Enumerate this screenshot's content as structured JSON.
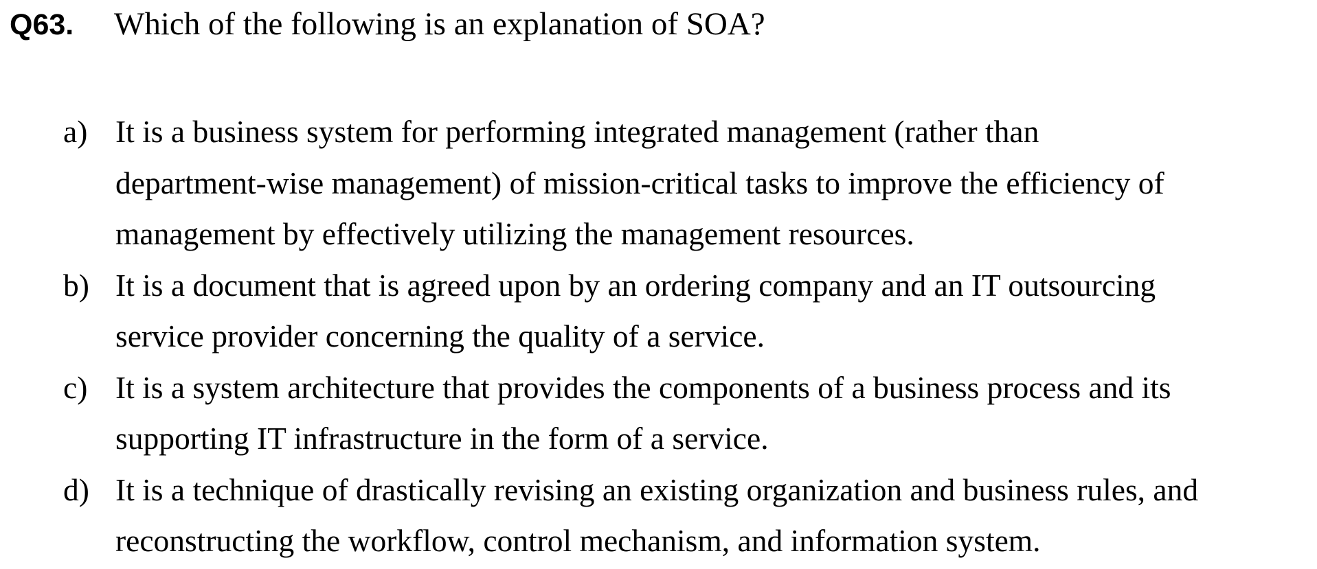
{
  "question": {
    "number": "Q63.",
    "text": "Which of the following is an explanation of SOA?"
  },
  "options": [
    {
      "label": "a)",
      "lines": [
        "It is a business system for performing integrated management (rather than",
        "department-wise management) of mission-critical tasks to improve the efficiency of",
        "management by effectively utilizing the management resources."
      ]
    },
    {
      "label": "b)",
      "lines": [
        "It is a document that is agreed upon by an ordering company and an IT outsourcing",
        "service provider concerning the quality of a service."
      ]
    },
    {
      "label": "c)",
      "lines": [
        "It is a system architecture that provides the components of a business process and its",
        "supporting IT infrastructure in the form of a service."
      ]
    },
    {
      "label": "d)",
      "lines": [
        "It is a technique of drastically revising an existing organization and business rules, and",
        "reconstructing the workflow, control mechanism, and information system."
      ]
    }
  ]
}
